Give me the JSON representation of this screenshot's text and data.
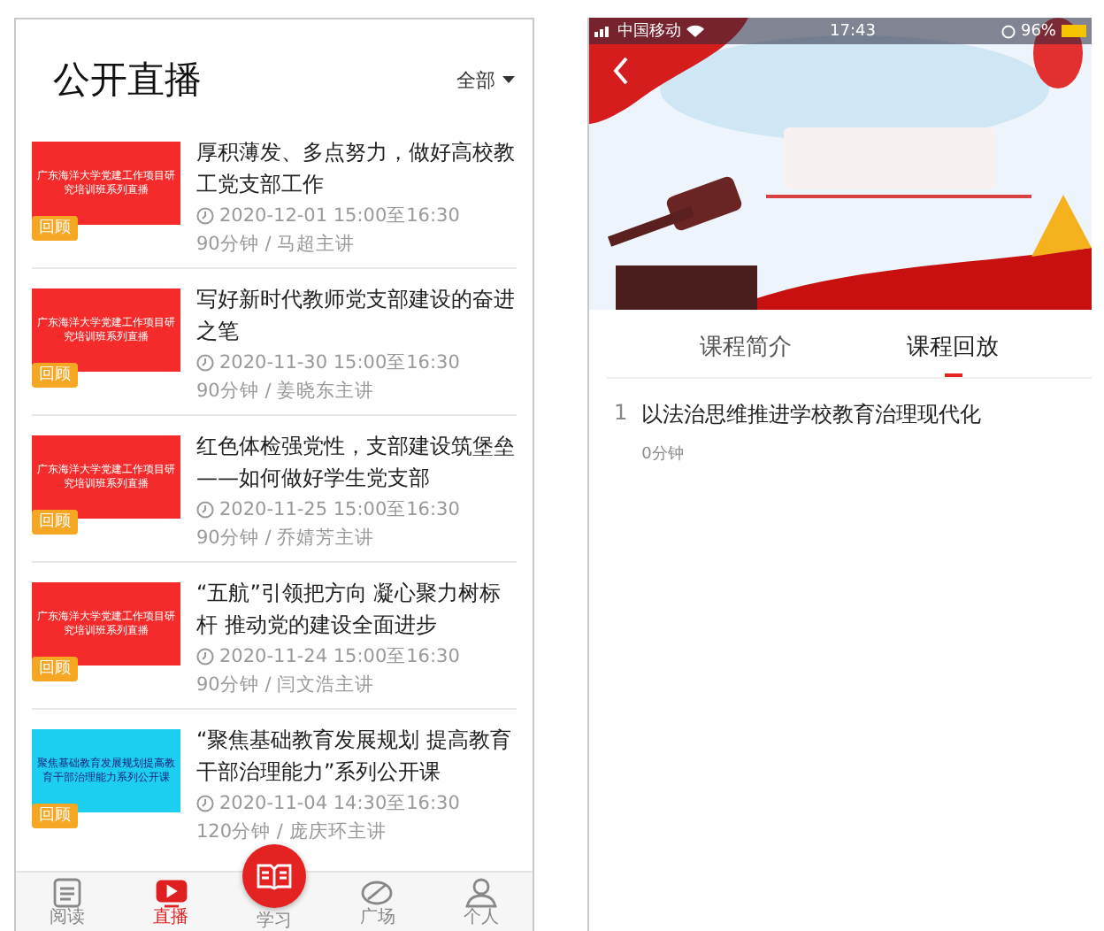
{
  "left_screen": {
    "title": "公开直播",
    "filter": "全部",
    "items": [
      {
        "color": "#f52a2a",
        "thumb_text": "广东海洋大学党建工作项目研究培训班系列直播",
        "badge": "回顾",
        "title": "厚积薄发、多点努力，做好高校教工党支部工作",
        "time": "2020-12-01 15:00至16:30",
        "meta": "90分钟 / 马超主讲"
      },
      {
        "color": "#f52a2a",
        "thumb_text": "广东海洋大学党建工作项目研究培训班系列直播",
        "badge": "回顾",
        "title": "写好新时代教师党支部建设的奋进之笔",
        "time": "2020-11-30 15:00至16:30",
        "meta": "90分钟 / 姜晓东主讲"
      },
      {
        "color": "#f52a2a",
        "thumb_text": "广东海洋大学党建工作项目研究培训班系列直播",
        "badge": "回顾",
        "title": "红色体检强党性，支部建设筑堡垒——如何做好学生党支部",
        "time": "2020-11-25 15:00至16:30",
        "meta": "90分钟 / 乔婧芳主讲"
      },
      {
        "color": "#f52a2a",
        "thumb_text": "广东海洋大学党建工作项目研究培训班系列直播",
        "badge": "回顾",
        "title": "“五航”引领把方向  凝心聚力树标杆  推动党的建设全面进步",
        "time": "2020-11-24 15:00至16:30",
        "meta": "90分钟 / 闫文浩主讲"
      },
      {
        "color": "#1ccff0",
        "thumb_text": "聚焦基础教育发展规划提高教育干部治理能力系列公开课",
        "badge": "回顾",
        "title": "“聚焦基础教育发展规划 提高教育干部治理能力”系列公开课",
        "time": "2020-11-04 14:30至16:30",
        "meta": "120分钟 / 庞庆环主讲"
      }
    ],
    "nav": [
      {
        "kind": "tab",
        "label": "阅读",
        "selected": false
      },
      {
        "kind": "tab",
        "label": "直播",
        "selected": true
      },
      {
        "kind": "center",
        "label": "学习",
        "selected": false
      },
      {
        "kind": "tab",
        "label": "广场",
        "selected": false
      },
      {
        "kind": "tab",
        "label": "个人",
        "selected": false
      }
    ]
  },
  "right_screen": {
    "status_bar": {
      "carrier": "中国移动",
      "time": "17:43",
      "battery": "96%"
    },
    "tabs": [
      {
        "label": "课程简介",
        "selected": false
      },
      {
        "label": "课程回放",
        "selected": true
      }
    ],
    "lessons": [
      {
        "index": "1",
        "title": "以法治思维推进学校教育治理现代化",
        "duration": "0分钟"
      }
    ]
  }
}
